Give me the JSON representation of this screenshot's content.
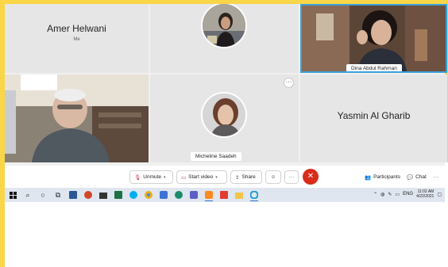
{
  "participants": [
    {
      "name": "Amer Helwani",
      "note": "Me"
    },
    {
      "name": "",
      "note": ""
    },
    {
      "name": "Dina Abdul Rahman",
      "note": ""
    },
    {
      "name": "",
      "note": ""
    },
    {
      "name": "Micheline Saadeh",
      "note": ""
    },
    {
      "name": "Yasmin Al Gharib",
      "note": ""
    }
  ],
  "toolbar": {
    "unmute": "Unmute",
    "start_video": "Start video",
    "share": "Share",
    "participants": "Participants",
    "chat": "Chat",
    "more": "···"
  },
  "tile_more": "···",
  "taskbar": {
    "lang": "ENG",
    "time": "11:02 AM",
    "date": "4/22/2021"
  },
  "colors": {
    "frame_yellow": "#f9d548",
    "active_border": "#3aa0d8",
    "end_call": "#d92c1c",
    "mute_red": "#c4314b"
  }
}
